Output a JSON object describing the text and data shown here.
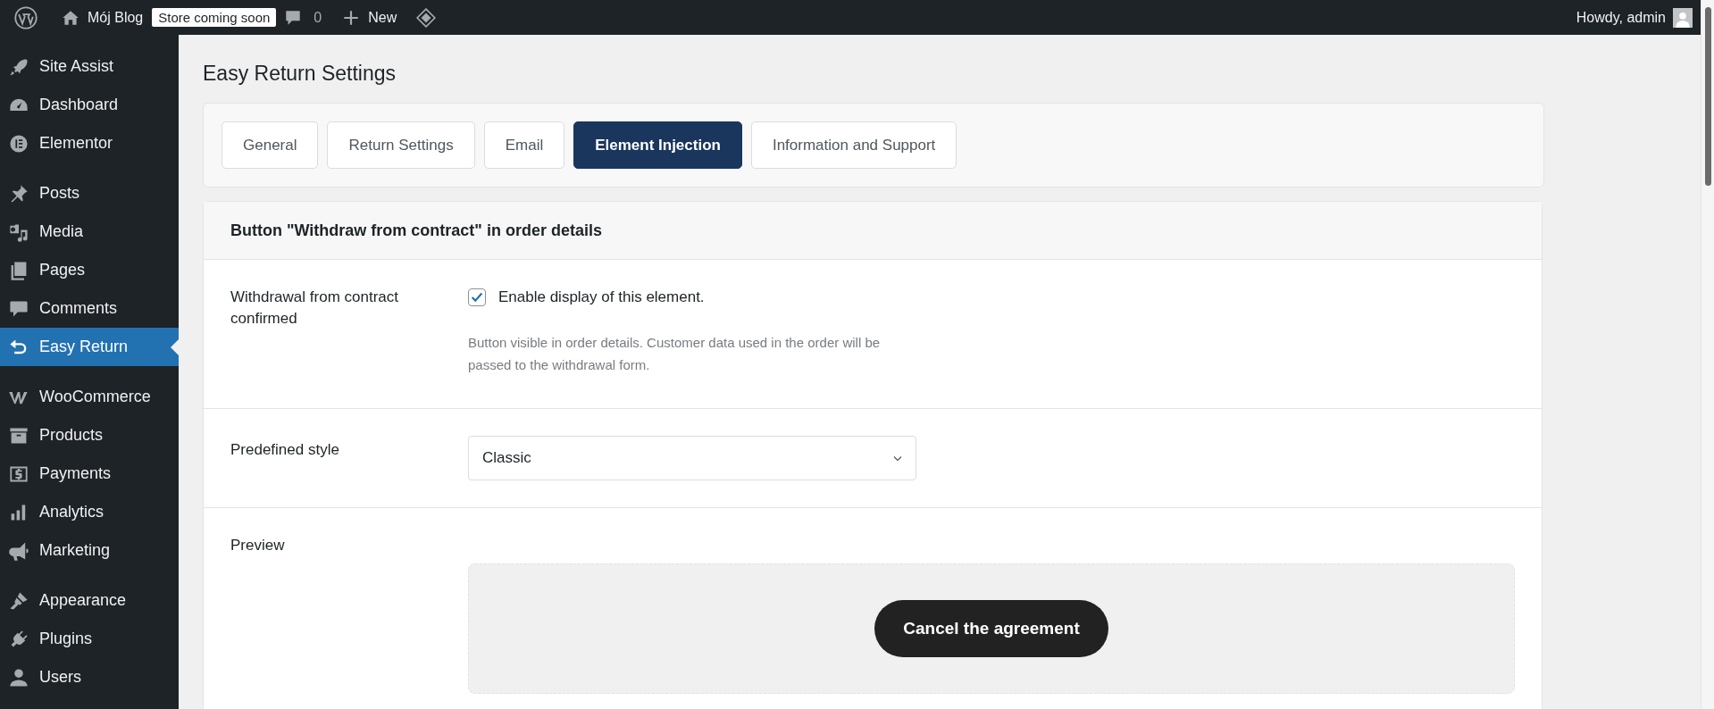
{
  "admin_bar": {
    "site_name": "Mój Blog",
    "store_badge": "Store coming soon",
    "comments_count": "0",
    "new_label": "New",
    "greeting": "Howdy, admin"
  },
  "sidebar": {
    "groups": [
      {
        "items": [
          {
            "label": "Site Assist",
            "selected": false
          },
          {
            "label": "Dashboard",
            "selected": false
          },
          {
            "label": "Elementor",
            "selected": false
          }
        ]
      },
      {
        "items": [
          {
            "label": "Posts",
            "selected": false
          },
          {
            "label": "Media",
            "selected": false
          },
          {
            "label": "Pages",
            "selected": false
          },
          {
            "label": "Comments",
            "selected": false
          },
          {
            "label": "Easy Return",
            "selected": true
          }
        ]
      },
      {
        "items": [
          {
            "label": "WooCommerce",
            "selected": false
          },
          {
            "label": "Products",
            "selected": false
          },
          {
            "label": "Payments",
            "selected": false
          },
          {
            "label": "Analytics",
            "selected": false
          },
          {
            "label": "Marketing",
            "selected": false
          }
        ]
      },
      {
        "items": [
          {
            "label": "Appearance",
            "selected": false
          },
          {
            "label": "Plugins",
            "selected": false
          },
          {
            "label": "Users",
            "selected": false
          }
        ]
      }
    ]
  },
  "page": {
    "title": "Easy Return Settings",
    "tabs": [
      {
        "label": "General",
        "selected": false
      },
      {
        "label": "Return Settings",
        "selected": false
      },
      {
        "label": "Email",
        "selected": false
      },
      {
        "label": "Element Injection",
        "selected": true
      },
      {
        "label": "Information and Support",
        "selected": false
      }
    ],
    "section": {
      "title": "Button \"Withdraw from contract\" in order details",
      "rows": [
        {
          "kind": "checkbox",
          "label": "Withdrawal from contract confirmed",
          "checkbox_label": "Enable display of this element.",
          "checked": true,
          "description": "Button visible in order details. Customer data used in the order will be passed to the withdrawal form."
        },
        {
          "kind": "select",
          "label": "Predefined style",
          "value": "Classic"
        },
        {
          "kind": "preview",
          "label": "Preview",
          "button_label": "Cancel the agreement"
        }
      ]
    }
  }
}
